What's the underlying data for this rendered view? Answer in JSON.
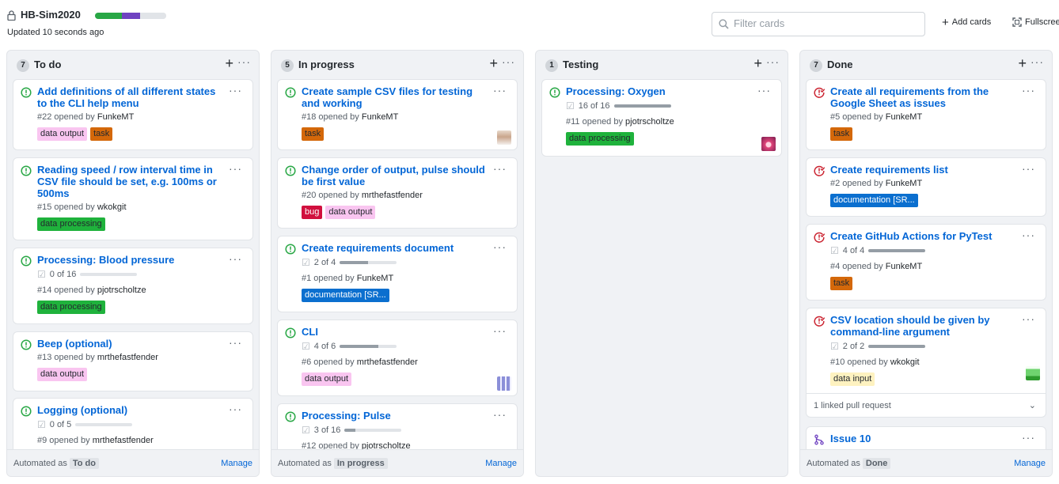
{
  "header": {
    "title": "HB-Sim2020",
    "updated": "Updated 10 seconds ago",
    "progress": {
      "done": 0.38,
      "in_progress": 0.25,
      "todo": 0.37,
      "colors": [
        "#28a745",
        "#6f42c1",
        "#e1e4e8"
      ]
    },
    "filter_placeholder": "Filter cards",
    "add_cards": "Add cards",
    "fullscreen": "Fullscreen"
  },
  "colors": {
    "link": "#0366d6",
    "open_issue": "#28a745",
    "closed_issue": "#cb2431",
    "pr_merged": "#6f42c1"
  },
  "columns": [
    {
      "name": "To do",
      "count": "7",
      "automation": "To do",
      "manage": "Manage",
      "automated_as": "Automated as",
      "cards": [
        {
          "title": "Add definitions of all different states to the CLI help menu",
          "meta_prefix": "#22 opened by ",
          "author": "FunkeMT",
          "state": "open",
          "labels": [
            {
              "name": "data output",
              "bg": "#f9c5f0",
              "fg": "#24292e"
            },
            {
              "name": "task",
              "bg": "#d4680a",
              "fg": "#24292e"
            }
          ]
        },
        {
          "title": "Reading speed / row interval time in CSV file should be set, e.g. 100ms or 500ms",
          "meta_prefix": "#15 opened by ",
          "author": "wkokgit",
          "state": "open",
          "labels": [
            {
              "name": "data processing",
              "bg": "#1fb23c",
              "fg": "#24292e"
            }
          ]
        },
        {
          "title": "Processing: Blood pressure",
          "tasks": "0 of 16",
          "task_fraction": 0,
          "meta_prefix": "#14 opened by ",
          "author": "pjotrscholtze",
          "state": "open",
          "labels": [
            {
              "name": "data processing",
              "bg": "#1fb23c",
              "fg": "#24292e"
            }
          ]
        },
        {
          "title": "Beep (optional)",
          "meta_prefix": "#13 opened by ",
          "author": "mrthefastfender",
          "state": "open",
          "labels": [
            {
              "name": "data output",
              "bg": "#f9c5f0",
              "fg": "#24292e"
            }
          ]
        },
        {
          "title": "Logging (optional)",
          "tasks": "0 of 5",
          "task_fraction": 0,
          "meta_prefix": "#9 opened by ",
          "author": "mrthefastfender",
          "state": "open",
          "labels": []
        }
      ]
    },
    {
      "name": "In progress",
      "count": "5",
      "automation": "In progress",
      "manage": "Manage",
      "automated_as": "Automated as",
      "cards": [
        {
          "title": "Create sample CSV files for testing and working",
          "meta_prefix": "#18 opened by ",
          "author": "FunkeMT",
          "state": "open",
          "labels": [
            {
              "name": "task",
              "bg": "#d4680a",
              "fg": "#24292e"
            }
          ],
          "avatar": "photo"
        },
        {
          "title": "Change order of output, pulse should be first value",
          "meta_prefix": "#20 opened by ",
          "author": "mrthefastfender",
          "state": "open",
          "labels": [
            {
              "name": "bug",
              "bg": "#d1103e",
              "fg": "#ffffff"
            },
            {
              "name": "data output",
              "bg": "#f9c5f0",
              "fg": "#24292e"
            }
          ]
        },
        {
          "title": "Create requirements document",
          "tasks": "2 of 4",
          "task_fraction": 0.5,
          "meta_prefix": "#1 opened by ",
          "author": "FunkeMT",
          "state": "open",
          "labels": [
            {
              "name": "documentation [SR...",
              "bg": "#0b6fcf",
              "fg": "#ffffff"
            }
          ]
        },
        {
          "title": "CLI",
          "tasks": "4 of 6",
          "task_fraction": 0.67,
          "meta_prefix": "#6 opened by ",
          "author": "mrthefastfender",
          "state": "open",
          "labels": [
            {
              "name": "data output",
              "bg": "#f9c5f0",
              "fg": "#24292e"
            }
          ],
          "avatar": "identicon"
        },
        {
          "title": "Processing: Pulse",
          "tasks": "3 of 16",
          "task_fraction": 0.19,
          "meta_prefix": "#12 opened by ",
          "author": "pjotrscholtze",
          "state": "open",
          "labels": []
        }
      ]
    },
    {
      "name": "Testing",
      "count": "1",
      "automation": "",
      "manage": "",
      "automated_as": "",
      "cards": [
        {
          "title": "Processing: Oxygen",
          "tasks": "16 of 16",
          "task_fraction": 1,
          "meta_prefix": "#11 opened by ",
          "author": "pjotrscholtze",
          "state": "open",
          "labels": [
            {
              "name": "data processing",
              "bg": "#1fb23c",
              "fg": "#24292e"
            }
          ],
          "avatar": "sunset"
        }
      ]
    },
    {
      "name": "Done",
      "count": "7",
      "automation": "Done",
      "manage": "Manage",
      "automated_as": "Automated as",
      "cards": [
        {
          "title": "Create all requirements from the Google Sheet as issues",
          "meta_prefix": "#5 opened by ",
          "author": "FunkeMT",
          "state": "closed",
          "labels": [
            {
              "name": "task",
              "bg": "#d4680a",
              "fg": "#24292e"
            }
          ]
        },
        {
          "title": "Create requirements list",
          "meta_prefix": "#2 opened by ",
          "author": "FunkeMT",
          "state": "closed",
          "labels": [
            {
              "name": "documentation [SR...",
              "bg": "#0b6fcf",
              "fg": "#ffffff"
            }
          ]
        },
        {
          "title": "Create GitHub Actions for PyTest",
          "tasks": "4 of 4",
          "task_fraction": 1,
          "meta_prefix": "#4 opened by ",
          "author": "FunkeMT",
          "state": "closed",
          "labels": [
            {
              "name": "task",
              "bg": "#d4680a",
              "fg": "#24292e"
            }
          ]
        },
        {
          "title": "CSV location should be given by command-line argument",
          "tasks": "2 of 2",
          "task_fraction": 1,
          "meta_prefix": "#10 opened by ",
          "author": "wkokgit",
          "state": "closed",
          "labels": [
            {
              "name": "data input",
              "bg": "#fef2c0",
              "fg": "#24292e"
            }
          ],
          "avatar": "green",
          "linked": "1 linked pull request"
        },
        {
          "title": "Issue 10",
          "state": "pr",
          "labels": []
        }
      ]
    }
  ]
}
